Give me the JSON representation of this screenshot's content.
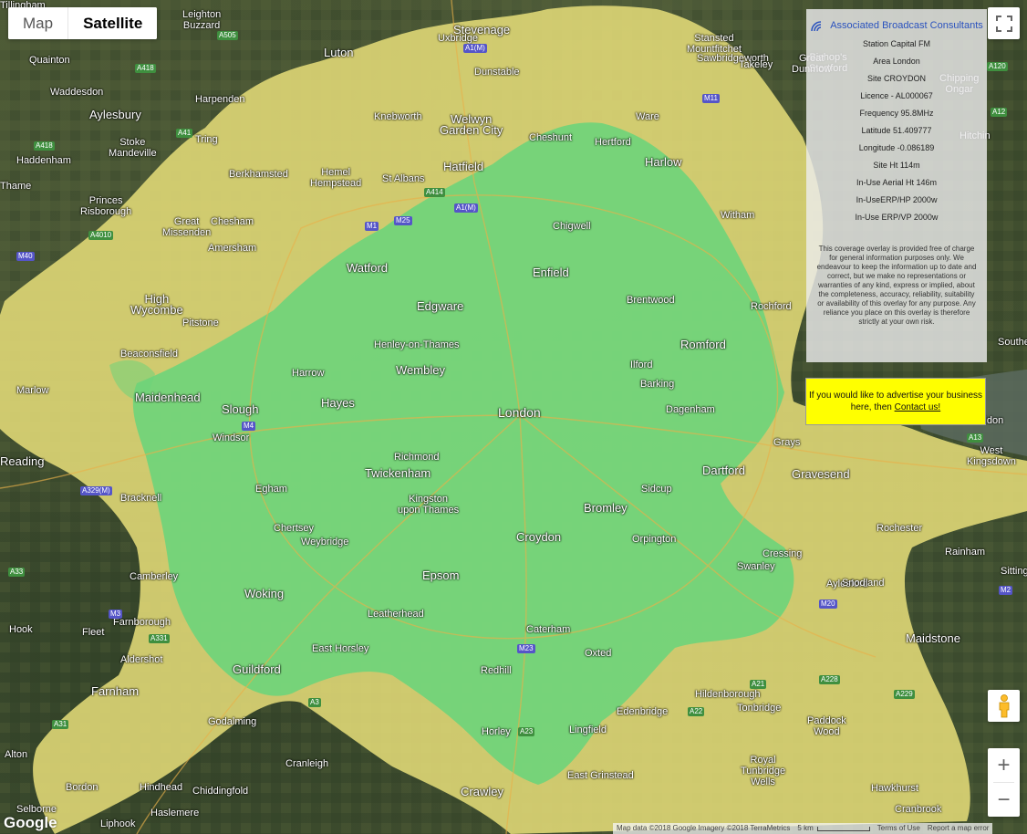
{
  "map_type": {
    "map_label": "Map",
    "satellite_label": "Satellite",
    "active": "Satellite"
  },
  "info": {
    "logo_text": "Associated Broadcast Consultants",
    "lines": [
      "Station Capital FM",
      "Area London",
      "Site CROYDON",
      "Licence - AL000067",
      "Frequency 95.8MHz",
      "Latitude 51.409777",
      "Longitude -0.086189",
      "Site Ht 114m",
      "In-Use Aerial Ht 146m",
      "In-UseERP/HP 2000w",
      "In-Use ERP/VP 2000w"
    ],
    "notice": "This coverage overlay is provided free of charge for general information purposes only. We endeavour to keep the information up to date and correct, but we make no representations or warranties of any kind, express or implied, about the completeness, accuracy, reliability, suitability or availability of this overlay for any purpose. Any reliance you place on this overlay is therefore strictly at your own risk."
  },
  "ad": {
    "text": "If you would like to advertise your business here, then",
    "link": "Contact us!"
  },
  "attribution": {
    "map_data": "Map data ©2018 Google Imagery ©2018 TerraMetrics",
    "scale": "5 km",
    "terms": "Terms of Use",
    "report": "Report a map error"
  },
  "google_logo": "Google",
  "colors": {
    "coverage_strong": "#6dd47a",
    "coverage_weak": "#e3db78",
    "terrain": "#3d4a2d"
  },
  "places": [
    {
      "name": "Luton",
      "cls": "big"
    },
    {
      "name": "Stevenage",
      "cls": "big"
    },
    {
      "name": "Aylesbury",
      "cls": "big"
    },
    {
      "name": "Welwyn\nGarden City",
      "cls": "big"
    },
    {
      "name": "Hatfield",
      "cls": "big"
    },
    {
      "name": "Harlow",
      "cls": "big"
    },
    {
      "name": "Watford",
      "cls": "big"
    },
    {
      "name": "Enfield",
      "cls": "big"
    },
    {
      "name": "High\nWycombe",
      "cls": "big"
    },
    {
      "name": "Slough",
      "cls": "big"
    },
    {
      "name": "Romford",
      "cls": "big"
    },
    {
      "name": "London",
      "cls": "huge"
    },
    {
      "name": "Twickenham",
      "cls": "big"
    },
    {
      "name": "Croydon",
      "cls": "big"
    },
    {
      "name": "Bromley",
      "cls": "big"
    },
    {
      "name": "Reading",
      "cls": "big"
    },
    {
      "name": "Woking",
      "cls": "big"
    },
    {
      "name": "Guildford",
      "cls": "big"
    },
    {
      "name": "Maidstone",
      "cls": "big"
    },
    {
      "name": "Crawley",
      "cls": "big"
    },
    {
      "name": "Farnham",
      "cls": "big"
    },
    {
      "name": "Gravesend",
      "cls": "big"
    },
    {
      "name": "Dartford",
      "cls": "big"
    },
    {
      "name": "Epsom",
      "cls": "big"
    },
    {
      "name": "Maidenhead",
      "cls": "big"
    },
    {
      "name": "Hayes",
      "cls": "big"
    },
    {
      "name": "Wembley",
      "cls": "big"
    },
    {
      "name": "Edgware",
      "cls": "big"
    },
    {
      "name": "Richmond",
      "cls": ""
    },
    {
      "name": "Kingston\nupon Thames",
      "cls": ""
    },
    {
      "name": "Orpington",
      "cls": ""
    },
    {
      "name": "Sidcup",
      "cls": ""
    },
    {
      "name": "Ilford",
      "cls": ""
    },
    {
      "name": "Barking",
      "cls": ""
    },
    {
      "name": "Dagenham",
      "cls": ""
    },
    {
      "name": "Leatherhead",
      "cls": ""
    },
    {
      "name": "Caterham",
      "cls": ""
    },
    {
      "name": "Redhill",
      "cls": ""
    },
    {
      "name": "Oxted",
      "cls": ""
    },
    {
      "name": "Chertsey",
      "cls": ""
    },
    {
      "name": "Weybridge",
      "cls": ""
    },
    {
      "name": "Egham",
      "cls": ""
    },
    {
      "name": "Windsor",
      "cls": ""
    },
    {
      "name": "Bracknell",
      "cls": ""
    },
    {
      "name": "Camberley",
      "cls": ""
    },
    {
      "name": "Farnborough",
      "cls": ""
    },
    {
      "name": "Fleet",
      "cls": ""
    },
    {
      "name": "Hook",
      "cls": ""
    },
    {
      "name": "Aldershot",
      "cls": ""
    },
    {
      "name": "Alton",
      "cls": ""
    },
    {
      "name": "Bordon",
      "cls": ""
    },
    {
      "name": "Hindhead",
      "cls": ""
    },
    {
      "name": "Haslemere",
      "cls": ""
    },
    {
      "name": "Selborne",
      "cls": ""
    },
    {
      "name": "Liphook",
      "cls": ""
    },
    {
      "name": "Chiddingfold",
      "cls": ""
    },
    {
      "name": "Cranleigh",
      "cls": ""
    },
    {
      "name": "Godalming",
      "cls": ""
    },
    {
      "name": "East Horsley",
      "cls": ""
    },
    {
      "name": "Horley",
      "cls": ""
    },
    {
      "name": "East Grinstead",
      "cls": ""
    },
    {
      "name": "Lingfield",
      "cls": ""
    },
    {
      "name": "Edenbridge",
      "cls": ""
    },
    {
      "name": "Tonbridge",
      "cls": ""
    },
    {
      "name": "Royal\nTunbridge\nWells",
      "cls": ""
    },
    {
      "name": "Hildenborough",
      "cls": ""
    },
    {
      "name": "Paddock\nWood",
      "cls": ""
    },
    {
      "name": "Hawkhurst",
      "cls": ""
    },
    {
      "name": "Cranbrook",
      "cls": ""
    },
    {
      "name": "Aylesford",
      "cls": ""
    },
    {
      "name": "Snodland",
      "cls": ""
    },
    {
      "name": "Rochester",
      "cls": ""
    },
    {
      "name": "Rainham",
      "cls": ""
    },
    {
      "name": "Sittingbourne",
      "cls": ""
    },
    {
      "name": "Grays",
      "cls": ""
    },
    {
      "name": "Basildon",
      "cls": ""
    },
    {
      "name": "Southend",
      "cls": ""
    },
    {
      "name": "Rochford",
      "cls": ""
    },
    {
      "name": "Brentwood",
      "cls": ""
    },
    {
      "name": "Chigwell",
      "cls": ""
    },
    {
      "name": "Cheshunt",
      "cls": ""
    },
    {
      "name": "Hertford",
      "cls": ""
    },
    {
      "name": "Ware",
      "cls": ""
    },
    {
      "name": "Sawbridgeworth",
      "cls": ""
    },
    {
      "name": "Bishop's\nStortford",
      "cls": ""
    },
    {
      "name": "Takeley",
      "cls": ""
    },
    {
      "name": "Great\nDunmow",
      "cls": ""
    },
    {
      "name": "Stansted\nMountfitchet",
      "cls": ""
    },
    {
      "name": "Hemel\nHempstead",
      "cls": ""
    },
    {
      "name": "St Albans",
      "cls": ""
    },
    {
      "name": "Berkhamsted",
      "cls": ""
    },
    {
      "name": "Tring",
      "cls": ""
    },
    {
      "name": "Chesham",
      "cls": ""
    },
    {
      "name": "Amersham",
      "cls": ""
    },
    {
      "name": "Great\nMissenden",
      "cls": ""
    },
    {
      "name": "Princes\nRisborough",
      "cls": ""
    },
    {
      "name": "Stoke\nMandeville",
      "cls": ""
    },
    {
      "name": "Haddenham",
      "cls": ""
    },
    {
      "name": "Thame",
      "cls": ""
    },
    {
      "name": "Waddesdon",
      "cls": ""
    },
    {
      "name": "Quainton",
      "cls": ""
    },
    {
      "name": "Leighton\nBuzzard",
      "cls": ""
    },
    {
      "name": "Dunstable",
      "cls": ""
    },
    {
      "name": "Knebworth",
      "cls": ""
    },
    {
      "name": "Harpenden",
      "cls": ""
    },
    {
      "name": "Pitstone",
      "cls": ""
    },
    {
      "name": "Beaconsfield",
      "cls": ""
    },
    {
      "name": "Marlow",
      "cls": ""
    },
    {
      "name": "Henley-on-Thames",
      "cls": ""
    },
    {
      "name": "Harrow",
      "cls": ""
    },
    {
      "name": "Uxbridge",
      "cls": ""
    },
    {
      "name": "Hitchin",
      "cls": ""
    },
    {
      "name": "Witham",
      "cls": ""
    },
    {
      "name": "Chipping\nOngar",
      "cls": ""
    },
    {
      "name": "Cressing",
      "cls": ""
    },
    {
      "name": "Swanley",
      "cls": ""
    },
    {
      "name": "West\nKingsdown",
      "cls": ""
    },
    {
      "name": "Tillingham",
      "cls": ""
    }
  ],
  "roads": [
    {
      "label": "A505",
      "kind": "a"
    },
    {
      "label": "A1(M)",
      "kind": "m"
    },
    {
      "label": "A418",
      "kind": "a"
    },
    {
      "label": "M11",
      "kind": "m"
    },
    {
      "label": "A41",
      "kind": "a"
    },
    {
      "label": "A418",
      "kind": "a"
    },
    {
      "label": "A4010",
      "kind": "a"
    },
    {
      "label": "M40",
      "kind": "m"
    },
    {
      "label": "M25",
      "kind": "m"
    },
    {
      "label": "M1",
      "kind": "m"
    },
    {
      "label": "A1(M)",
      "kind": "m"
    },
    {
      "label": "A414",
      "kind": "a"
    },
    {
      "label": "A12",
      "kind": "a"
    },
    {
      "label": "A13",
      "kind": "a"
    },
    {
      "label": "M4",
      "kind": "m"
    },
    {
      "label": "A329(M)",
      "kind": "m"
    },
    {
      "label": "M3",
      "kind": "m"
    },
    {
      "label": "A331",
      "kind": "a"
    },
    {
      "label": "A31",
      "kind": "a"
    },
    {
      "label": "A33",
      "kind": "a"
    },
    {
      "label": "M20",
      "kind": "m"
    },
    {
      "label": "M2",
      "kind": "m"
    },
    {
      "label": "A228",
      "kind": "a"
    },
    {
      "label": "A229",
      "kind": "a"
    },
    {
      "label": "A3",
      "kind": "a"
    },
    {
      "label": "A23",
      "kind": "a"
    },
    {
      "label": "A21",
      "kind": "a"
    },
    {
      "label": "A22",
      "kind": "a"
    },
    {
      "label": "M23",
      "kind": "m"
    },
    {
      "label": "A120",
      "kind": "a"
    }
  ]
}
